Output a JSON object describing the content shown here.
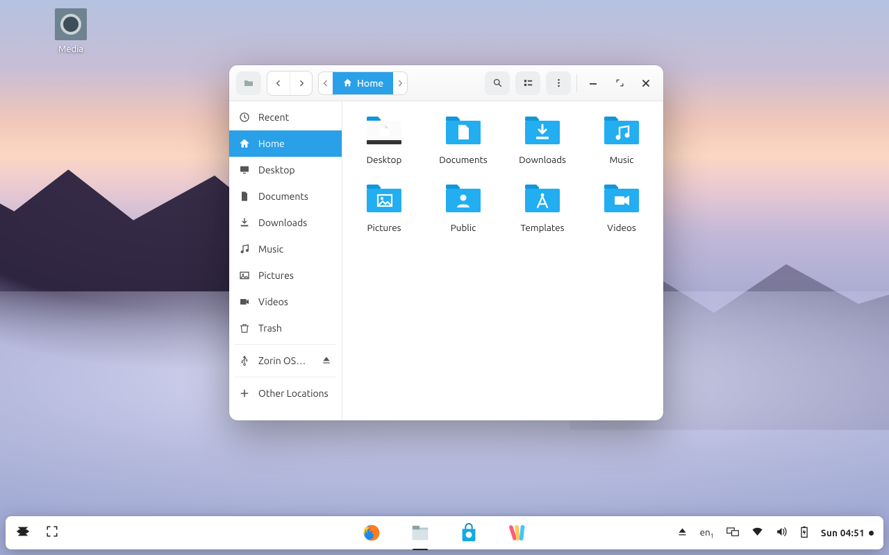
{
  "desktop": {
    "icon_label": "Media"
  },
  "window": {
    "breadcrumb": {
      "home": "Home"
    },
    "sidebar": [
      {
        "icon": "clock",
        "label": "Recent",
        "active": false
      },
      {
        "icon": "home",
        "label": "Home",
        "active": true
      },
      {
        "icon": "desktop",
        "label": "Desktop"
      },
      {
        "icon": "file",
        "label": "Documents"
      },
      {
        "icon": "download",
        "label": "Downloads"
      },
      {
        "icon": "music",
        "label": "Music"
      },
      {
        "icon": "image",
        "label": "Pictures"
      },
      {
        "icon": "video",
        "label": "Videos"
      },
      {
        "icon": "trash",
        "label": "Trash"
      },
      {
        "sep": true
      },
      {
        "icon": "usb",
        "label": "Zorin OS…",
        "eject": true
      },
      {
        "sep": true
      },
      {
        "icon": "plus",
        "label": "Other Locations"
      }
    ],
    "folders": [
      {
        "name": "Desktop",
        "glyph": "desktop"
      },
      {
        "name": "Documents",
        "glyph": "file"
      },
      {
        "name": "Downloads",
        "glyph": "download"
      },
      {
        "name": "Music",
        "glyph": "music"
      },
      {
        "name": "Pictures",
        "glyph": "image"
      },
      {
        "name": "Public",
        "glyph": "person"
      },
      {
        "name": "Templates",
        "glyph": "compass"
      },
      {
        "name": "Videos",
        "glyph": "video"
      }
    ]
  },
  "taskbar": {
    "lang": "en",
    "lang_sub": "1",
    "clock": "Sun 04:51"
  }
}
